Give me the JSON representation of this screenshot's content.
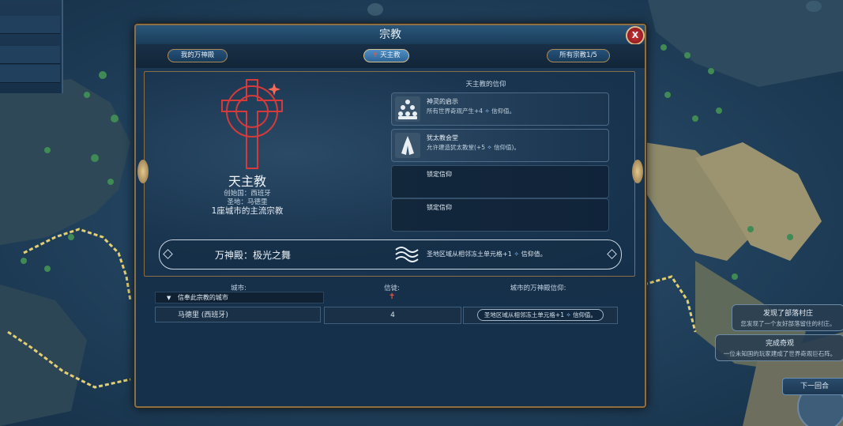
{
  "window": {
    "title": "宗教",
    "close_label": "X"
  },
  "tabs": [
    {
      "label": "我的万神殿",
      "active": false
    },
    {
      "label": "天主教",
      "active": true
    },
    {
      "label": "所有宗教1/5",
      "active": false
    }
  ],
  "religion": {
    "name": "天主教",
    "founder": "创始国：西班牙",
    "holy_city": "圣地：马德里",
    "followers": "1座城市的主流宗教",
    "icon": "celtic-cross-icon",
    "icon_color": "#d63a3a"
  },
  "beliefs": {
    "title": "天主教的信仰",
    "items": [
      {
        "name": "神灵的启示",
        "desc": "所有世界奇观产生+4",
        "unit": "信仰值。",
        "icon": "prophets-icon"
      },
      {
        "name": "犹太教会堂",
        "desc": "允许建造犹太教堂(+5",
        "unit": "信仰值)。",
        "icon": "praying-hands-icon"
      },
      {
        "name": "锁定信仰",
        "desc": "",
        "unit": "",
        "icon": ""
      },
      {
        "name": "锁定信仰",
        "desc": "",
        "unit": "",
        "icon": ""
      }
    ]
  },
  "pantheon": {
    "label": "万神殿：极光之舞",
    "desc": "圣地区域从相邻冻土单元格+1",
    "unit": "信仰值。",
    "icon": "aurora-icon"
  },
  "city_table": {
    "headers": {
      "city": "城市:",
      "followers": "信徒:",
      "pantheon": "城市的万神殿信仰:"
    },
    "filter_label": "信奉此宗教的城市",
    "rows": [
      {
        "city": "马德里 (西班牙)",
        "followers": "4",
        "pantheon": "圣地区域从相邻冻土单元格+1",
        "unit": "信仰值。"
      }
    ]
  },
  "notifications": [
    {
      "title": "发现了部落村庄",
      "desc": "您发现了一个友好部落留住的村庄。"
    },
    {
      "title": "完成奇观",
      "desc": "一位未知国的玩家建成了世界奇观巨石阵。"
    }
  ],
  "next_turn_label": "下一回合",
  "colors": {
    "faith": "#8fc2ff",
    "frame_gold": "#8c6f45",
    "close_red": "#c0262b"
  }
}
